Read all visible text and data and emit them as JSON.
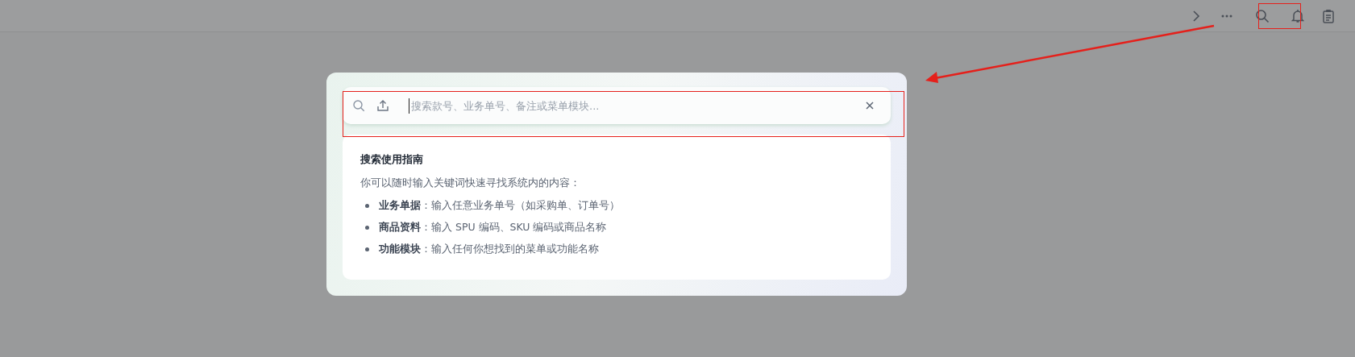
{
  "search_dialog": {
    "search_field": {
      "placeholder": "搜索款号、业务单号、备注或菜单模块..."
    },
    "guide": {
      "title": "搜索使用指南",
      "intro": "你可以随时输入关键词快速寻找系统内的内容：",
      "items": [
        "**业务单据**：输入任意业务单号（如采购单、订单号）",
        "**商品资料**：输入 SPU 编码、SKU 编码或商品名称",
        "**功能模块**：输入任何你想找到的菜单或功能名称"
      ]
    }
  }
}
